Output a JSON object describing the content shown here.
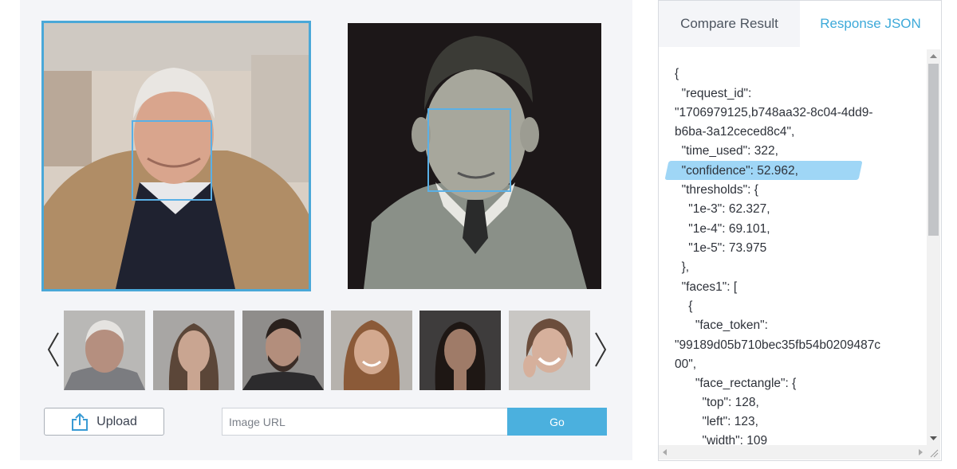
{
  "left": {
    "url_input": {
      "placeholder": "Image URL",
      "value": ""
    },
    "upload_label": "Upload",
    "go_label": "Go",
    "thumbnails": [
      {
        "name": "thumb-old-man"
      },
      {
        "name": "thumb-woman-1"
      },
      {
        "name": "thumb-man-beard"
      },
      {
        "name": "thumb-girl"
      },
      {
        "name": "thumb-woman-2"
      },
      {
        "name": "thumb-woman-smiling"
      }
    ]
  },
  "right": {
    "tabs": [
      {
        "label": "Compare Result",
        "active": false
      },
      {
        "label": "Response JSON",
        "active": true
      }
    ],
    "json_lines": [
      "{",
      "  \"request_id\":",
      "\"1706979125,b748aa32-8c04-4dd9-",
      "b6ba-3a12ceced8c4\",",
      "  \"time_used\": 322,",
      "  \"confidence\": 52.962,",
      "  \"thresholds\": {",
      "    \"1e-3\": 62.327,",
      "    \"1e-4\": 69.101,",
      "    \"1e-5\": 73.975",
      "  },",
      "  \"faces1\": [",
      "    {",
      "      \"face_token\":",
      "\"99189d05b710bec35fb54b0209487c",
      "00\",",
      "      \"face_rectangle\": {",
      "        \"top\": 128,",
      "        \"left\": 123,",
      "        \"width\": 109"
    ]
  },
  "colors": {
    "accent": "#4bb0de",
    "tab_active": "#3da9d9",
    "highlight": "#8ecff5",
    "face_box": "#5ab0e6"
  },
  "icons": {
    "upload": "upload-icon",
    "prev": "chevron-left-icon",
    "next": "chevron-right-icon"
  }
}
